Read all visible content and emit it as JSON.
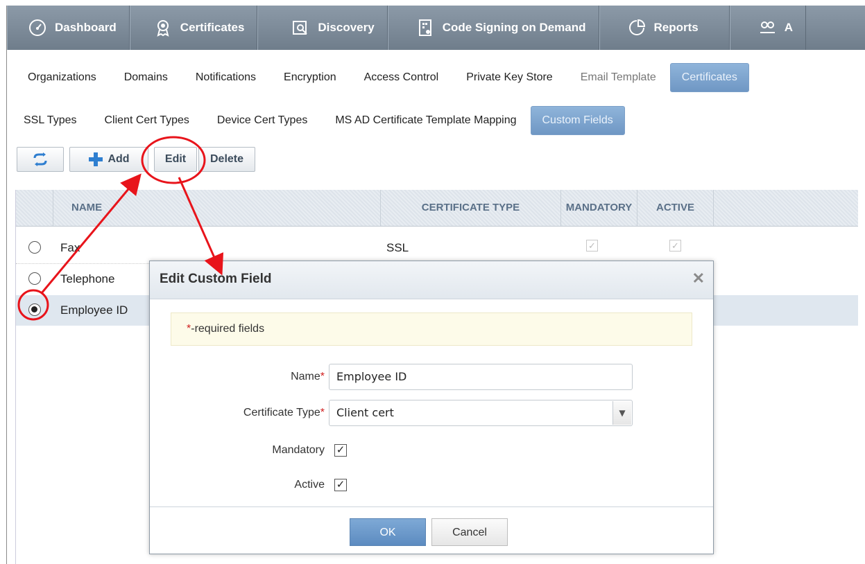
{
  "topnav": {
    "items": [
      {
        "label": "Dashboard",
        "icon": "gauge-icon"
      },
      {
        "label": "Certificates",
        "icon": "certificate-badge-icon"
      },
      {
        "label": "Discovery",
        "icon": "magnifier-document-icon"
      },
      {
        "label": "Code Signing on Demand",
        "icon": "code-document-icon"
      },
      {
        "label": "Reports",
        "icon": "pie-chart-icon"
      },
      {
        "label": "A",
        "icon": "admin-icon"
      }
    ]
  },
  "settings_tabs": {
    "items": [
      "Organizations",
      "Domains",
      "Notifications",
      "Encryption",
      "Access Control",
      "Private Key Store",
      "Email Template",
      "Certificates"
    ],
    "active": "Certificates"
  },
  "cert_tabs": {
    "items": [
      "SSL Types",
      "Client Cert Types",
      "Device Cert Types",
      "MS AD Certificate Template Mapping",
      "Custom Fields"
    ],
    "active": "Custom Fields"
  },
  "toolbar": {
    "refresh_icon": "refresh-icon",
    "add_label": "Add",
    "edit_label": "Edit",
    "delete_label": "Delete"
  },
  "table": {
    "columns": [
      "NAME",
      "CERTIFICATE TYPE",
      "MANDATORY",
      "ACTIVE"
    ],
    "rows": [
      {
        "name": "Fax",
        "certificate_type": "SSL",
        "mandatory": true,
        "active": true,
        "selected": false
      },
      {
        "name": "Telephone",
        "certificate_type": "",
        "mandatory": null,
        "active": null,
        "selected": false
      },
      {
        "name": "Employee ID",
        "certificate_type": "",
        "mandatory": null,
        "active": null,
        "selected": true
      }
    ]
  },
  "dialog": {
    "title": "Edit Custom Field",
    "required_note_star": "*",
    "required_note": "-required fields",
    "fields": {
      "name_label": "Name",
      "name_value": "Employee ID",
      "certificate_type_label": "Certificate Type",
      "certificate_type_value": "Client cert",
      "mandatory_label": "Mandatory",
      "mandatory_checked": true,
      "active_label": "Active",
      "active_checked": true,
      "required_star": "*"
    },
    "ok_label": "OK",
    "cancel_label": "Cancel"
  },
  "annotation_color": "#e8141b",
  "accent_color": "#6f97c4"
}
